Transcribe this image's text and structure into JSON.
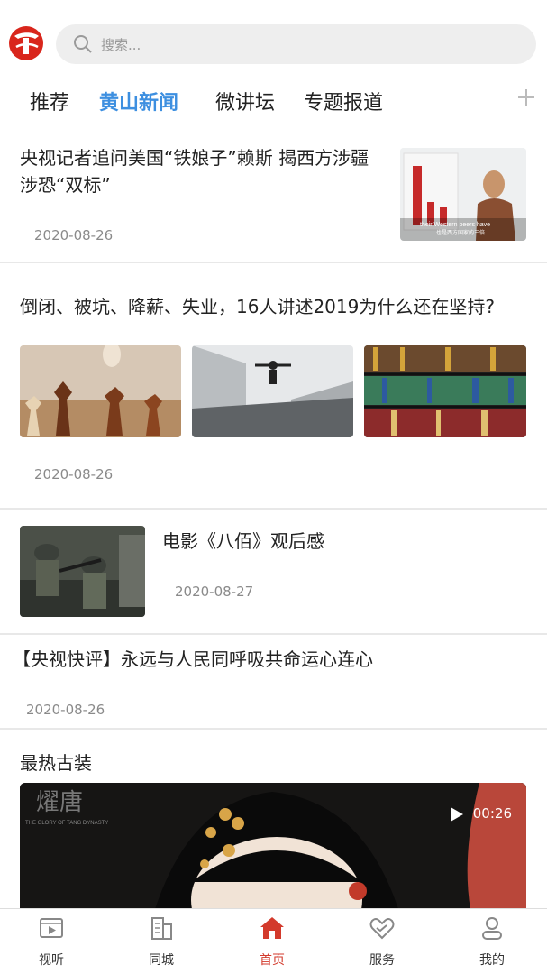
{
  "header": {
    "search_placeholder": "搜索..."
  },
  "tabs": [
    {
      "label": "推荐",
      "active": false
    },
    {
      "label": "黄山新闻",
      "active": true
    },
    {
      "label": "微讲坛",
      "active": false
    },
    {
      "label": "专题报道",
      "active": false
    }
  ],
  "articles": [
    {
      "title": "央视记者追问美国“铁娘子”赖斯 揭西方涉疆涉恐“双标”",
      "date": "2020-08-26",
      "thumb_caption": "their Western peers have",
      "thumb_subcaption": "也是西方国家的三倍"
    },
    {
      "title": "倒闭、被坑、降薪、失业，16人讲述2019为什么还在坚持?",
      "date": "2020-08-26"
    },
    {
      "title": "电影《八佰》观后感",
      "date": "2020-08-27"
    },
    {
      "title": "【央视快评】永远与人民同呼吸共命运心连心",
      "date": "2020-08-26"
    }
  ],
  "section": {
    "title": "最热古装",
    "video": {
      "duration": "00:26",
      "poster_text": "燿唐",
      "poster_subtext": "THE GLORY OF TANG DYNASTY"
    }
  },
  "bottom_nav": [
    {
      "label": "视听",
      "icon": "video-icon",
      "active": false
    },
    {
      "label": "同城",
      "icon": "building-icon",
      "active": false
    },
    {
      "label": "首页",
      "icon": "home-icon",
      "active": true
    },
    {
      "label": "服务",
      "icon": "heart-hand-icon",
      "active": false
    },
    {
      "label": "我的",
      "icon": "user-icon",
      "active": false
    }
  ],
  "colors": {
    "accent": "#3d8fe0",
    "brand_red": "#d33a2c"
  }
}
